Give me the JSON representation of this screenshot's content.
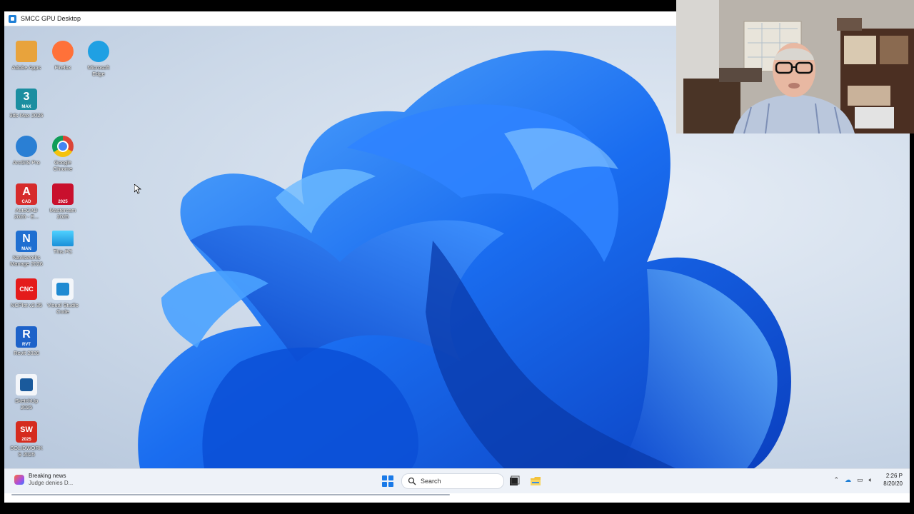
{
  "window": {
    "title": "SMCC GPU Desktop"
  },
  "desktop_icons": [
    {
      "label": "Adobe Apps",
      "icon": "adobe-apps-icon",
      "color": "#e8a33c"
    },
    {
      "label": "Firefox",
      "icon": "firefox-icon",
      "color": "#ff7139"
    },
    {
      "label": "Microsoft Edge",
      "icon": "edge-icon",
      "color": "#1fa0e3"
    },
    {
      "label": "3ds Max 2026",
      "icon": "3dsmax-icon",
      "color": "#1b8ea0",
      "glyph": "3",
      "sub": "MAX"
    },
    {
      "label": "ArcGIS Pro",
      "icon": "arcgis-icon",
      "color": "#2a7fd4"
    },
    {
      "label": "Google Chrome",
      "icon": "chrome-icon",
      "color": "#db4437"
    },
    {
      "label": "AutoCAD 2026 - E...",
      "icon": "autocad-icon",
      "color": "#d62b2b",
      "glyph": "A",
      "sub": "CAD"
    },
    {
      "label": "Mastercam 2025",
      "icon": "mastercam-icon",
      "color": "#c9102d",
      "sub": "2025"
    },
    {
      "label": "Navisworks Manage 2026",
      "icon": "navisworks-icon",
      "color": "#1f6fd1",
      "glyph": "N",
      "sub": "MAN"
    },
    {
      "label": "This PC",
      "icon": "this-pc-icon",
      "color": "#2bb1e6"
    },
    {
      "label": "NCPlot v2.35",
      "icon": "ncplot-icon",
      "color": "#e41b1b",
      "glyph": "CNC"
    },
    {
      "label": "Visual Studio Code",
      "icon": "vscode-icon",
      "color": "#1f8ad2"
    },
    {
      "label": "Revit 2026",
      "icon": "revit-icon",
      "color": "#1d62c9",
      "glyph": "R",
      "sub": "RVT"
    },
    {
      "label": "SketchUp 2025",
      "icon": "sketchup-icon",
      "color": "#1a5a9c"
    },
    {
      "label": "SOLIDWORKS 2025",
      "icon": "solidworks-icon",
      "color": "#d52b1e",
      "glyph": "SW",
      "sub": "2025"
    }
  ],
  "taskbar": {
    "news_title": "Breaking news",
    "news_sub": "Judge denies D...",
    "search_placeholder": "Search",
    "time": "2:26 P",
    "date": "8/20/20"
  },
  "colors": {
    "bloom_primary": "#1a6df0",
    "bloom_dark": "#0a3fbf",
    "bloom_light": "#4aa2ff",
    "taskbar_bg": "#eef2f8"
  }
}
